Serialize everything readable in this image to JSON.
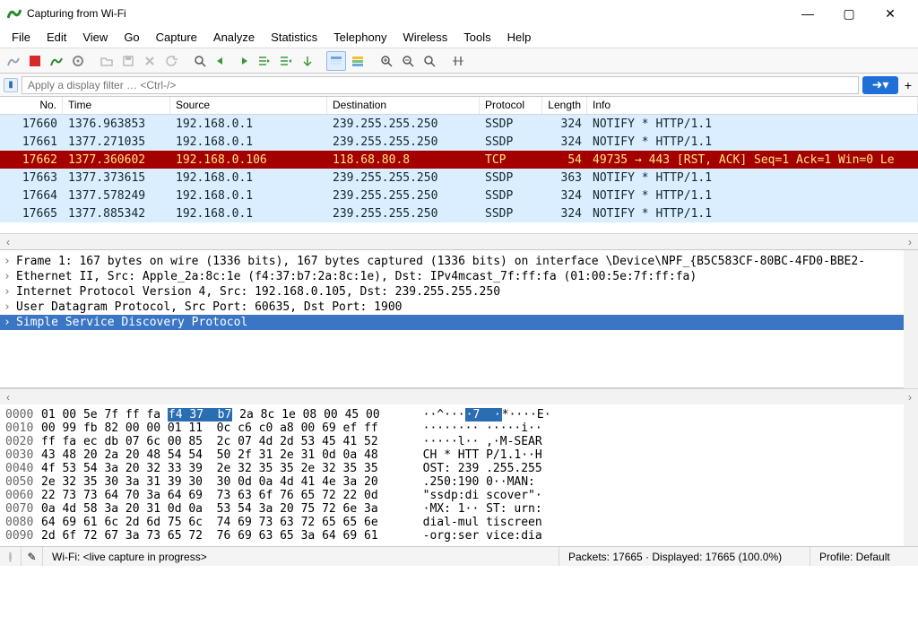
{
  "window": {
    "title": "Capturing from Wi-Fi"
  },
  "menu": [
    "File",
    "Edit",
    "View",
    "Go",
    "Capture",
    "Analyze",
    "Statistics",
    "Telephony",
    "Wireless",
    "Tools",
    "Help"
  ],
  "filter": {
    "placeholder": "Apply a display filter … <Ctrl-/>"
  },
  "columns": {
    "no": "No.",
    "time": "Time",
    "src": "Source",
    "dst": "Destination",
    "proto": "Protocol",
    "len": "Length",
    "info": "Info"
  },
  "packets": [
    {
      "no": "17660",
      "time": "1376.963853",
      "src": "192.168.0.1",
      "dst": "239.255.255.250",
      "proto": "SSDP",
      "len": "324",
      "info": "NOTIFY * HTTP/1.1",
      "color": "blue"
    },
    {
      "no": "17661",
      "time": "1377.271035",
      "src": "192.168.0.1",
      "dst": "239.255.255.250",
      "proto": "SSDP",
      "len": "324",
      "info": "NOTIFY * HTTP/1.1",
      "color": "blue"
    },
    {
      "no": "17662",
      "time": "1377.360602",
      "src": "192.168.0.106",
      "dst": "118.68.80.8",
      "proto": "TCP",
      "len": "54",
      "info": "49735 → 443 [RST, ACK] Seq=1 Ack=1 Win=0 Le",
      "color": "red"
    },
    {
      "no": "17663",
      "time": "1377.373615",
      "src": "192.168.0.1",
      "dst": "239.255.255.250",
      "proto": "SSDP",
      "len": "363",
      "info": "NOTIFY * HTTP/1.1",
      "color": "blue"
    },
    {
      "no": "17664",
      "time": "1377.578249",
      "src": "192.168.0.1",
      "dst": "239.255.255.250",
      "proto": "SSDP",
      "len": "324",
      "info": "NOTIFY * HTTP/1.1",
      "color": "blue"
    },
    {
      "no": "17665",
      "time": "1377.885342",
      "src": "192.168.0.1",
      "dst": "239.255.255.250",
      "proto": "SSDP",
      "len": "324",
      "info": "NOTIFY * HTTP/1.1",
      "color": "blue"
    }
  ],
  "tree": [
    "Frame 1: 167 bytes on wire (1336 bits), 167 bytes captured (1336 bits) on interface \\Device\\NPF_{B5C583CF-80BC-4FD0-BBE2-",
    "Ethernet II, Src: Apple_2a:8c:1e (f4:37:b7:2a:8c:1e), Dst: IPv4mcast_7f:ff:fa (01:00:5e:7f:ff:fa)",
    "Internet Protocol Version 4, Src: 192.168.0.105, Dst: 239.255.255.250",
    "User Datagram Protocol, Src Port: 60635, Dst Port: 1900",
    "Simple Service Discovery Protocol"
  ],
  "hex": [
    {
      "off": "0000",
      "b1": "01 00 5e 7f ff fa ",
      "hl": "f4 37  b7",
      "b2": " 2a 8c 1e 08 00 45 00",
      "a1": "··^···",
      "ahl": "·7  ·",
      "a2": "*····E·"
    },
    {
      "off": "0010",
      "b1": "00 99 fb 82 00 00 01 11  0c c6 c0 a8 00 69 ef ff",
      "a": "········ ·····i··"
    },
    {
      "off": "0020",
      "b1": "ff fa ec db 07 6c 00 85  2c 07 4d 2d 53 45 41 52",
      "a": "·····l·· ,·M-SEAR"
    },
    {
      "off": "0030",
      "b1": "43 48 20 2a 20 48 54 54  50 2f 31 2e 31 0d 0a 48",
      "a": "CH * HTT P/1.1··H"
    },
    {
      "off": "0040",
      "b1": "4f 53 54 3a 20 32 33 39  2e 32 35 35 2e 32 35 35",
      "a": "OST: 239 .255.255"
    },
    {
      "off": "0050",
      "b1": "2e 32 35 30 3a 31 39 30  30 0d 0a 4d 41 4e 3a 20",
      "a": ".250:190 0··MAN: "
    },
    {
      "off": "0060",
      "b1": "22 73 73 64 70 3a 64 69  73 63 6f 76 65 72 22 0d",
      "a": "\"ssdp:di scover\"·"
    },
    {
      "off": "0070",
      "b1": "0a 4d 58 3a 20 31 0d 0a  53 54 3a 20 75 72 6e 3a",
      "a": "·MX: 1·· ST: urn:"
    },
    {
      "off": "0080",
      "b1": "64 69 61 6c 2d 6d 75 6c  74 69 73 63 72 65 65 6e",
      "a": "dial-mul tiscreen"
    },
    {
      "off": "0090",
      "b1": "2d 6f 72 67 3a 73 65 72  76 69 63 65 3a 64 69 61",
      "a": "-org:ser vice:dia"
    }
  ],
  "status": {
    "left": "Wi-Fi: <live capture in progress>",
    "middle": "Packets: 17665 · Displayed: 17665 (100.0%)",
    "right": "Profile: Default"
  }
}
